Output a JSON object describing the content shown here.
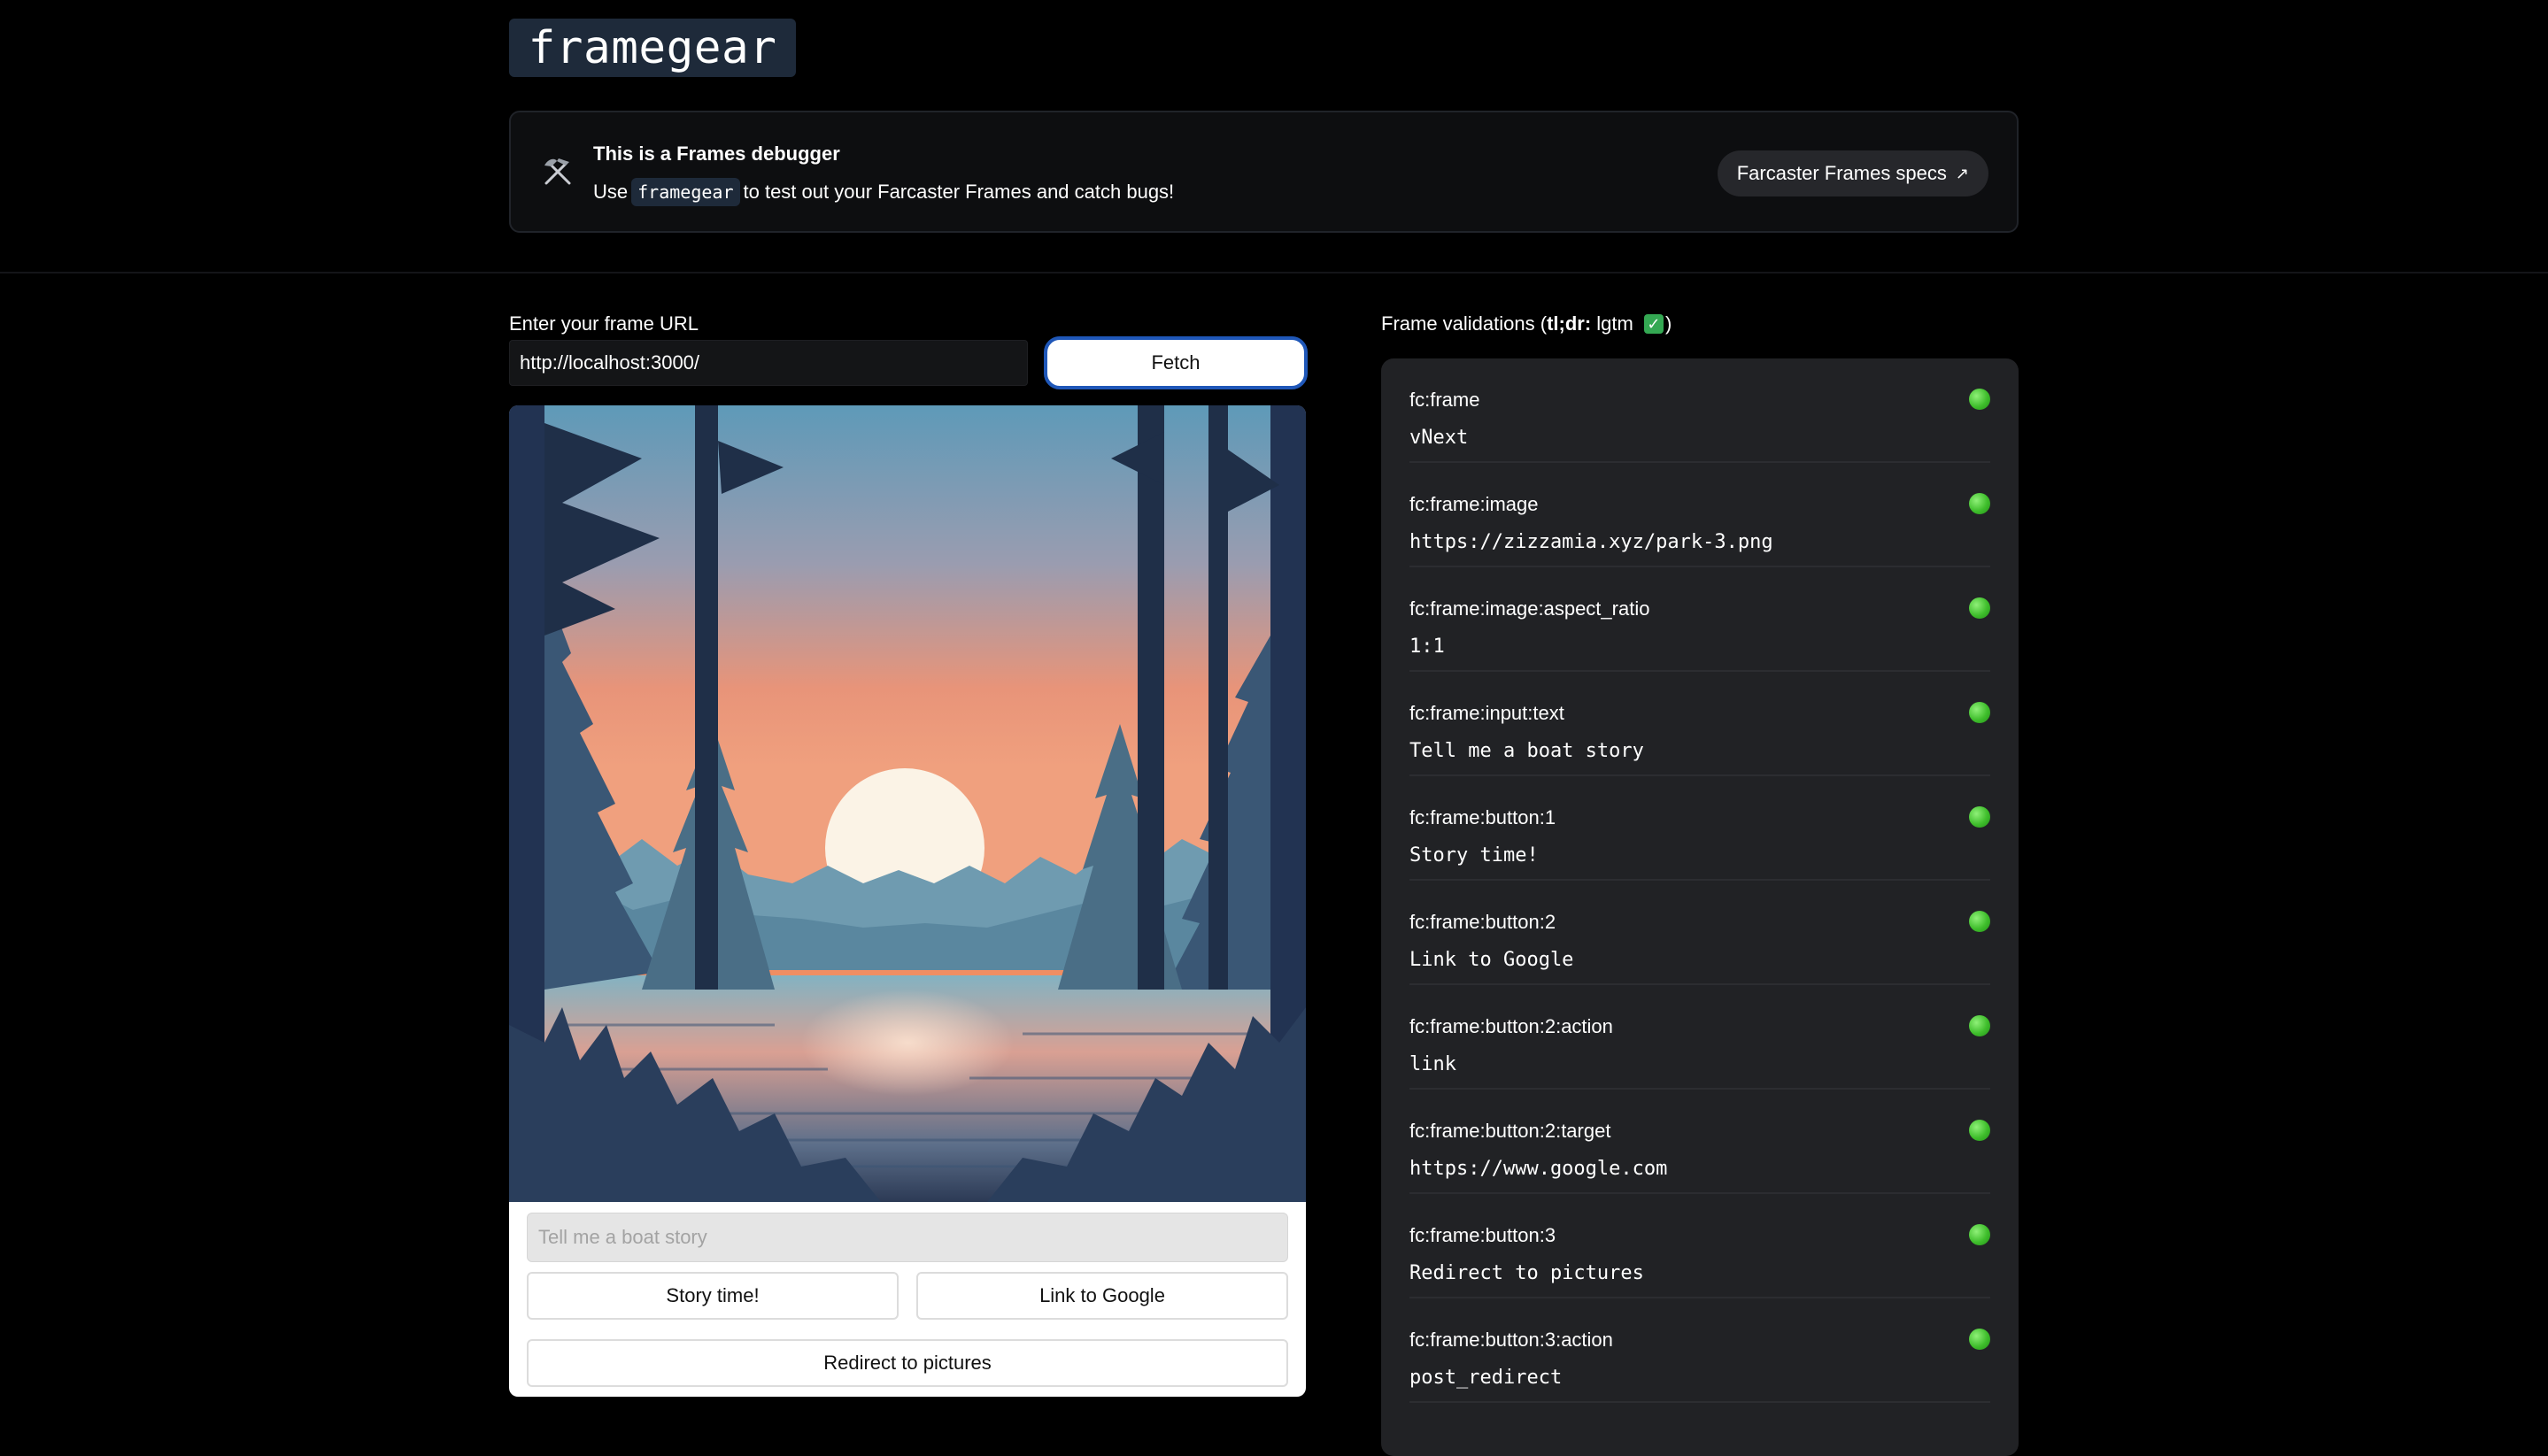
{
  "app": {
    "logo": "framegear"
  },
  "banner": {
    "title": "This is a Frames debugger",
    "desc_before": "Use",
    "desc_code": "framegear",
    "desc_after": "to test out your Farcaster Frames and catch bugs!",
    "specs_button": "Farcaster Frames specs",
    "specs_arrow": "↗",
    "icon": "hammer-pick-icon"
  },
  "url_form": {
    "label": "Enter your frame URL",
    "value": "http://localhost:3000/",
    "fetch_label": "Fetch"
  },
  "frame": {
    "image_description_icon": "landscape-image",
    "input_placeholder": "Tell me a boat story",
    "buttons": [
      "Story time!",
      "Link to Google",
      "Redirect to pictures"
    ]
  },
  "validations": {
    "heading_prefix": "Frame validations (",
    "heading_bold": "tl;dr:",
    "heading_text": " lgtm ",
    "heading_emoji": "✓",
    "heading_suffix": ")",
    "status_color": "#3fbe2c",
    "rows": [
      {
        "key": "fc:frame",
        "value": "vNext",
        "status": "valid"
      },
      {
        "key": "fc:frame:image",
        "value": "https://zizzamia.xyz/park-3.png",
        "status": "valid"
      },
      {
        "key": "fc:frame:image:aspect_ratio",
        "value": "1:1",
        "status": "valid"
      },
      {
        "key": "fc:frame:input:text",
        "value": "Tell me a boat story",
        "status": "valid"
      },
      {
        "key": "fc:frame:button:1",
        "value": "Story time!",
        "status": "valid"
      },
      {
        "key": "fc:frame:button:2",
        "value": "Link to Google",
        "status": "valid"
      },
      {
        "key": "fc:frame:button:2:action",
        "value": "link",
        "status": "valid"
      },
      {
        "key": "fc:frame:button:2:target",
        "value": "https://www.google.com",
        "status": "valid"
      },
      {
        "key": "fc:frame:button:3",
        "value": "Redirect to pictures",
        "status": "valid"
      },
      {
        "key": "fc:frame:button:3:action",
        "value": "post_redirect",
        "status": "valid"
      }
    ]
  }
}
